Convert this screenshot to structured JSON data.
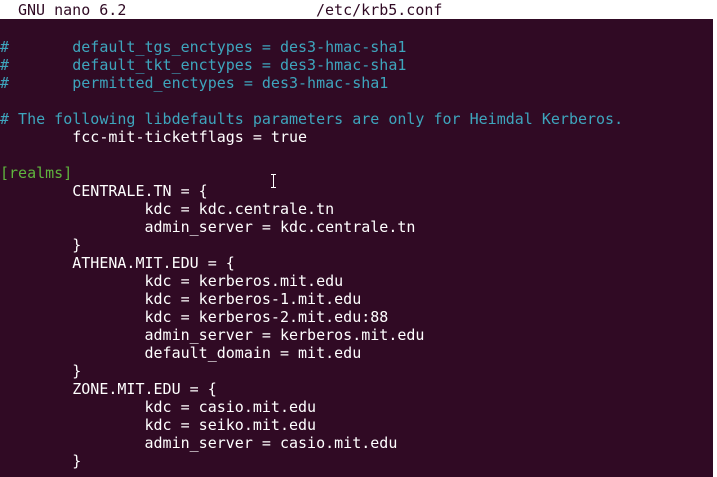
{
  "titlebar": {
    "app": "GNU nano 6.2",
    "file": "/etc/krb5.conf"
  },
  "lines": [
    {
      "text": "#       default_tgs_enctypes = des3-hmac-sha1",
      "kind": "comment"
    },
    {
      "text": "#       default_tkt_enctypes = des3-hmac-sha1",
      "kind": "comment"
    },
    {
      "text": "#       permitted_enctypes = des3-hmac-sha1",
      "kind": "comment"
    },
    {
      "text": "",
      "kind": "normal"
    },
    {
      "text": "# The following libdefaults parameters are only for Heimdal Kerberos.",
      "kind": "comment"
    },
    {
      "text": "        fcc-mit-ticketflags = true",
      "kind": "normal"
    },
    {
      "text": "",
      "kind": "normal"
    },
    {
      "text": "[realms]",
      "kind": "section"
    },
    {
      "text": "        CENTRALE.TN = {",
      "kind": "normal"
    },
    {
      "text": "                kdc = kdc.centrale.tn",
      "kind": "normal"
    },
    {
      "text": "                admin_server = kdc.centrale.tn",
      "kind": "normal"
    },
    {
      "text": "        }",
      "kind": "normal"
    },
    {
      "text": "        ATHENA.MIT.EDU = {",
      "kind": "normal"
    },
    {
      "text": "                kdc = kerberos.mit.edu",
      "kind": "normal"
    },
    {
      "text": "                kdc = kerberos-1.mit.edu",
      "kind": "normal"
    },
    {
      "text": "                kdc = kerberos-2.mit.edu:88",
      "kind": "normal"
    },
    {
      "text": "                admin_server = kerberos.mit.edu",
      "kind": "normal"
    },
    {
      "text": "                default_domain = mit.edu",
      "kind": "normal"
    },
    {
      "text": "        }",
      "kind": "normal"
    },
    {
      "text": "        ZONE.MIT.EDU = {",
      "kind": "normal"
    },
    {
      "text": "                kdc = casio.mit.edu",
      "kind": "normal"
    },
    {
      "text": "                kdc = seiko.mit.edu",
      "kind": "normal"
    },
    {
      "text": "                admin_server = casio.mit.edu",
      "kind": "normal"
    },
    {
      "text": "        }",
      "kind": "normal"
    }
  ],
  "colors": {
    "background": "#300a24",
    "comment": "#3ea5bd",
    "section": "#5fb53e",
    "text": "#ffffff"
  },
  "icons": {
    "pointer": "text-cursor-ibeam-icon"
  }
}
